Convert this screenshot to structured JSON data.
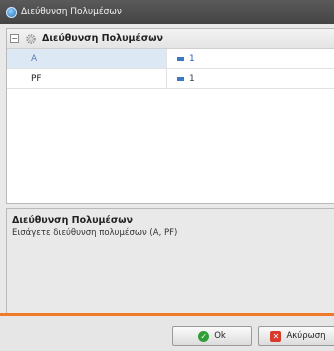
{
  "window": {
    "title": "Διεύθυνση Πολυμέσων"
  },
  "property_grid": {
    "group_title": "Διεύθυνση Πολυμέσων",
    "collapse_symbol": "−",
    "rows": [
      {
        "name": "A",
        "value": "1"
      },
      {
        "name": "PF",
        "value": "1"
      }
    ]
  },
  "description": {
    "title": "Διεύθυνση Πολυμέσων",
    "text": "Εισάγετε διεύθυνση πολυμέσων (A, PF)"
  },
  "buttons": {
    "ok_label": "Ok",
    "cancel_label": "Ακύρωση",
    "ok_icon": "✓",
    "cancel_icon": "✕"
  },
  "colors": {
    "accent_divider": "#f07a2a",
    "value_text": "#2a5db0",
    "ok_icon": "#2f9e36",
    "cancel_icon": "#d83a2c"
  }
}
